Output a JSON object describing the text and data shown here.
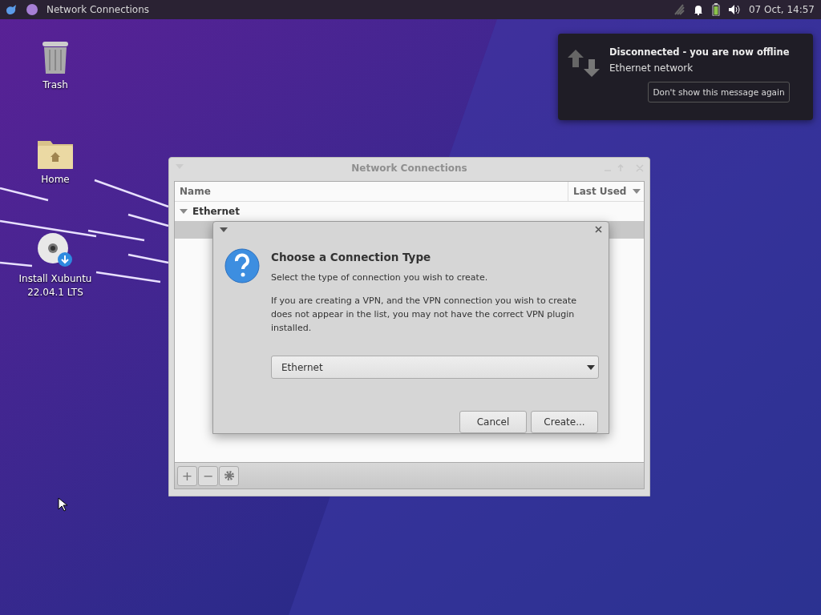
{
  "panel": {
    "window_button": "Network Connections",
    "clock": "07 Oct, 14:57"
  },
  "desktop_icons": [
    {
      "kind": "trash",
      "label": "Trash"
    },
    {
      "kind": "home",
      "label": "Home"
    },
    {
      "kind": "disc",
      "label": "Install Xubuntu 22.04.1 LTS"
    }
  ],
  "notification": {
    "title": "Disconnected - you are now offline",
    "body": "Ethernet network",
    "button": "Don't show this message again"
  },
  "window": {
    "title": "Network Connections",
    "columns": [
      "Name",
      "Last Used"
    ],
    "groups": [
      {
        "label": "Ethernet",
        "expanded": true,
        "children": [
          {
            "selected": true
          }
        ]
      }
    ],
    "toolbar": [
      "+",
      "−"
    ]
  },
  "dialog": {
    "title": "Choose a Connection Type",
    "subtitle": "Select the type of connection you wish to create.",
    "text": "If you are creating a VPN, and the VPN connection you wish to create does not appear in the list, you may not have the correct VPN plugin installed.",
    "select": "Ethernet",
    "buttons": [
      "Cancel",
      "Create..."
    ]
  }
}
